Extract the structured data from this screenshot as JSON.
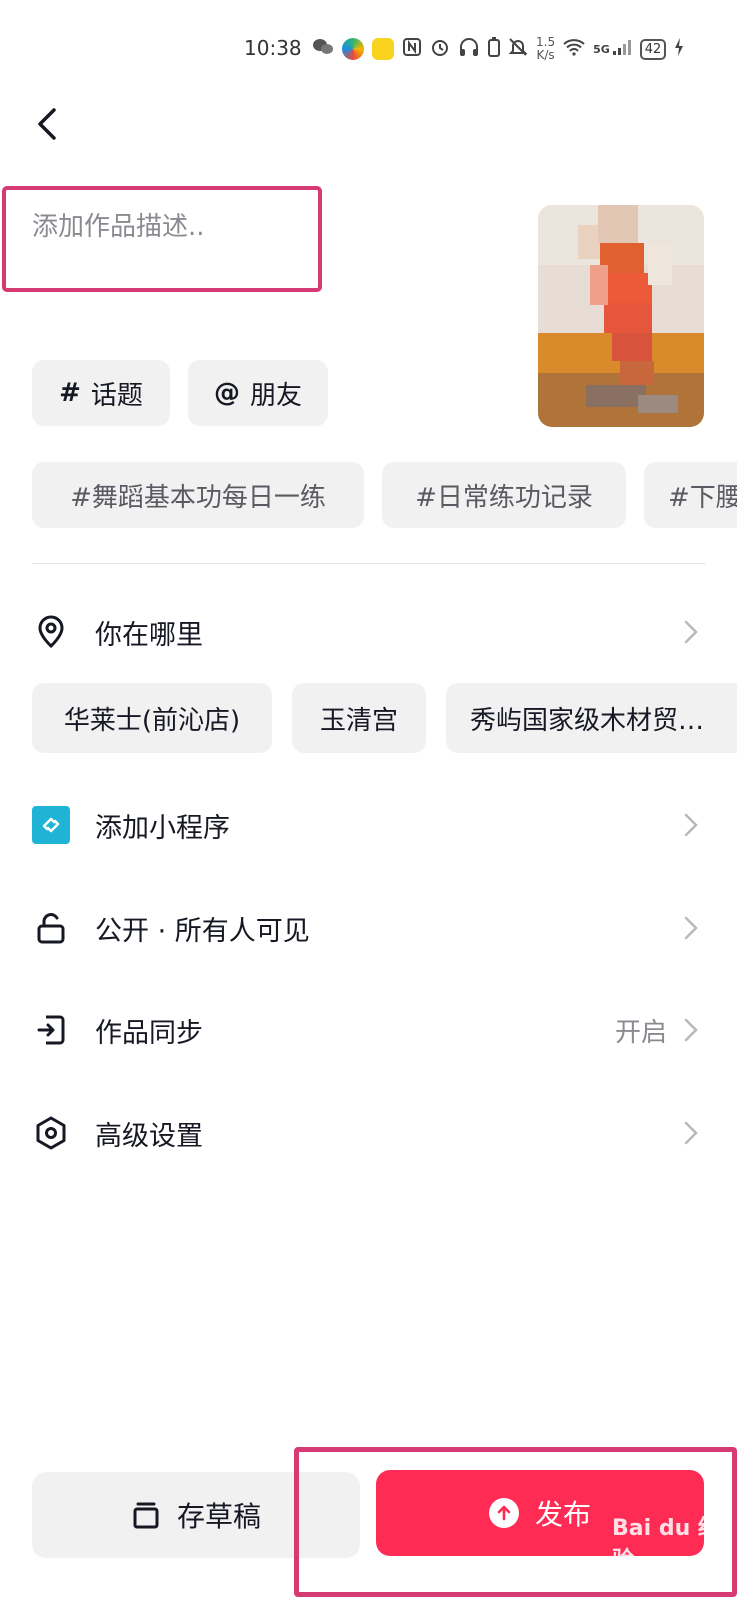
{
  "status_bar": {
    "time": "10:38",
    "speed_value": "1.5",
    "speed_unit": "K/s",
    "network": "5G",
    "battery": "42"
  },
  "description": {
    "placeholder": "添加作品描述.."
  },
  "tag_buttons": {
    "topic": {
      "symbol": "#",
      "label": "话题"
    },
    "friend": {
      "symbol": "@",
      "label": "朋友"
    }
  },
  "suggested_topics": [
    "#舞蹈基本功每日一练",
    "#日常练功记录",
    "#下腰"
  ],
  "location": {
    "label": "你在哪里",
    "suggestions": [
      "华莱士(前沁店)",
      "玉清宫",
      "秀屿国家级木材贸…"
    ]
  },
  "settings": {
    "mini_program": {
      "label": "添加小程序"
    },
    "visibility": {
      "label": "公开 · 所有人可见"
    },
    "sync": {
      "label": "作品同步",
      "value": "开启"
    },
    "advanced": {
      "label": "高级设置"
    }
  },
  "actions": {
    "draft_label": "存草稿",
    "publish_label": "发布"
  },
  "watermark": "Bai du 经验",
  "colors": {
    "accent": "#fe2c55",
    "highlight_frame": "#d63a73",
    "chip_bg": "#f1f1f2",
    "mini_program_icon": "#1fb4d6"
  }
}
